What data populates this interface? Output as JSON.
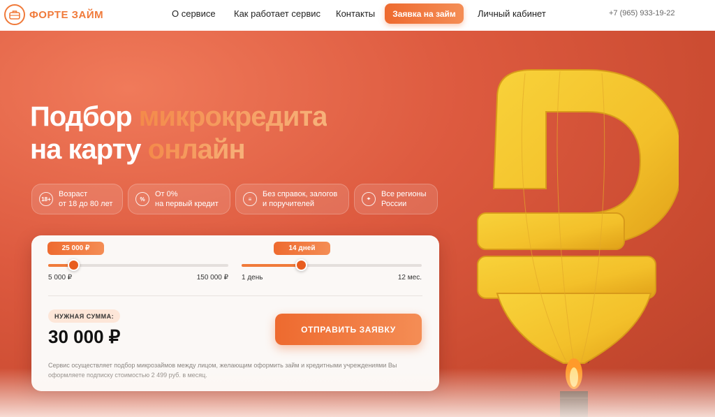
{
  "brand": {
    "name": "ФОРТЕ ЗАЙМ",
    "accent": "#f07a3a"
  },
  "nav": {
    "items": [
      "О сервисе",
      "Как работает сервис",
      "Контакты"
    ],
    "cta": "Заявка на займ",
    "account": "Личный кабинет",
    "phone": "+7 (965) 933-19-22"
  },
  "hero": {
    "line1_plain": "Подбор ",
    "line1_accent": "микрокредита",
    "line2_plain": "на карту ",
    "line2_accent": "онлайн",
    "features": [
      {
        "icon": "age-18-icon",
        "glyph": "18+",
        "line1": "Возраст",
        "line2": "от 18 до 80 лет"
      },
      {
        "icon": "percent-icon",
        "glyph": "%",
        "line1": "От 0%",
        "line2": "на первый кредит"
      },
      {
        "icon": "document-icon",
        "glyph": "≡",
        "line1": "Без справок, залогов",
        "line2": "и поручителей"
      },
      {
        "icon": "map-icon",
        "glyph": "⌖",
        "line1": "Все регионы",
        "line2": "России"
      }
    ]
  },
  "calculator": {
    "amount": {
      "badge": "25 000 ₽",
      "min": "5 000 ₽",
      "max": "150 000 ₽",
      "fraction": 0.14
    },
    "term": {
      "badge": "14 дней",
      "min": "1 день",
      "max": "12 мес.",
      "fraction": 0.33
    },
    "sum_label": "НУЖНАЯ СУММА:",
    "sum_value": "30 000 ₽",
    "submit": "ОТПРАВИТЬ ЗАЯВКУ",
    "disclaimer": "Сервис осуществляет подбор микрозаймов между лицом, желающим оформить займ и кредитными учреждениями Вы оформляете подписку стоимостью 2 499 руб. в месяц."
  }
}
